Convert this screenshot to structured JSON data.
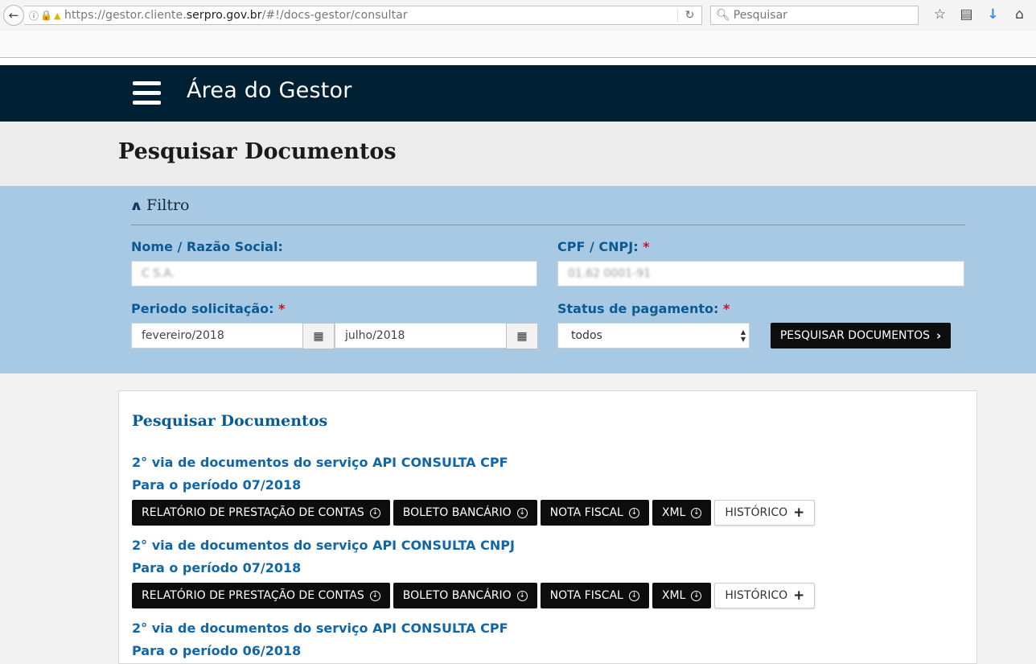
{
  "browser": {
    "url_prefix": "https://gestor.cliente.",
    "url_host": "serpro.gov.br",
    "url_suffix": "/#!/docs-gestor/consultar",
    "search_placeholder": "Pesquisar"
  },
  "header": {
    "title": "Área do Gestor"
  },
  "page": {
    "title": "Pesquisar Documentos"
  },
  "filter": {
    "toggle_label": "Filtro",
    "name_label": "Nome / Razão Social:",
    "name_value": "C  S.A.",
    "cpf_label": "CPF / CNPJ:",
    "cpf_value": "01.62  0001-91",
    "required_mark": "*",
    "period_label": "Periodo solicitação:",
    "period_start": "fevereiro/2018",
    "period_end": "julho/2018",
    "status_label": "Status de pagamento:",
    "status_value": "todos",
    "search_button": "PESQUISAR DOCUMENTOS"
  },
  "results": {
    "title": "Pesquisar Documentos",
    "items": [
      {
        "title": "2° via de documentos do serviço API CONSULTA CPF",
        "period": "Para o período 07/2018"
      },
      {
        "title": "2° via de documentos do serviço API CONSULTA CNPJ",
        "period": "Para o período 07/2018"
      },
      {
        "title": "2° via de documentos do serviço API CONSULTA CPF",
        "period": "Para o período 06/2018"
      }
    ],
    "buttons": {
      "report": "RELATÓRIO DE PRESTAÇÃO DE CONTAS",
      "boleto": "BOLETO BANCÁRIO",
      "nota": "NOTA FISCAL",
      "xml": "XML",
      "history": "HISTÓRICO"
    }
  }
}
